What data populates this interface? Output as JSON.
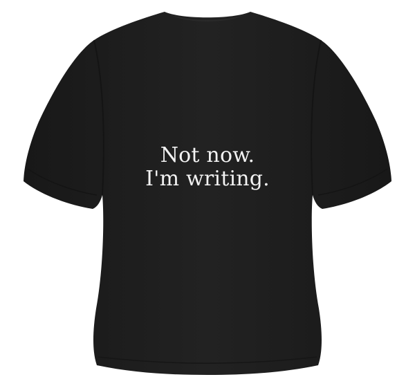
{
  "product": {
    "garment_type": "t-shirt",
    "shirt_color": "#1f1f1f",
    "background_color": "#ffffff",
    "print_color": "#f2f2f2"
  },
  "print": {
    "line1": "Not now.",
    "line2": "I'm writing."
  }
}
